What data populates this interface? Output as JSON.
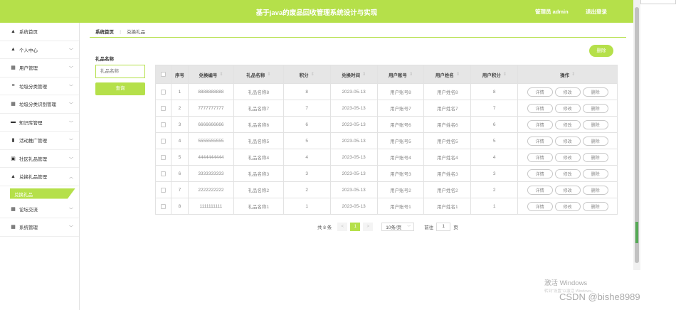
{
  "header": {
    "title": "基于java的废品回收管理系统设计与实现",
    "user": "管理员 admin",
    "logout": "退出登录"
  },
  "sidebar": {
    "items": [
      {
        "label": "系统首页",
        "icon": "home-icon",
        "glyph": "▲",
        "chevron": ""
      },
      {
        "label": "个人中心",
        "icon": "person-icon",
        "glyph": "▲",
        "chevron": "﹀"
      },
      {
        "label": "用户管理",
        "icon": "grid-icon",
        "glyph": "▦",
        "chevron": "﹀"
      },
      {
        "label": "垃圾分类管理",
        "icon": "list-icon",
        "glyph": "≡",
        "chevron": "﹀"
      },
      {
        "label": "垃圾分类识别管理",
        "icon": "grid-icon",
        "glyph": "▦",
        "chevron": "﹀"
      },
      {
        "label": "知识库管理",
        "icon": "monitor-icon",
        "glyph": "▬",
        "chevron": "﹀"
      },
      {
        "label": "活动推广管理",
        "icon": "chart-icon",
        "glyph": "▮",
        "chevron": "﹀"
      },
      {
        "label": "社区礼品管理",
        "icon": "box-icon",
        "glyph": "▣",
        "chevron": "﹀"
      },
      {
        "label": "兑换礼品管理",
        "icon": "person-icon",
        "glyph": "▲",
        "chevron": "︿"
      }
    ],
    "submenu_active": "兑换礼品",
    "items_after": [
      {
        "label": "论坛交流",
        "icon": "grid-icon",
        "glyph": "▦",
        "chevron": "﹀"
      },
      {
        "label": "系统管理",
        "icon": "grid-icon",
        "glyph": "▦",
        "chevron": "﹀"
      }
    ]
  },
  "breadcrumb": {
    "home": "系统首页",
    "sep": "⋮",
    "current": "兑换礼品"
  },
  "search": {
    "label": "礼品名称",
    "placeholder": "礼品名称",
    "button": "查询"
  },
  "toolbar": {
    "delete_label": "删除"
  },
  "table": {
    "columns": [
      "序号",
      "兑换编号",
      "礼品名称",
      "积分",
      "兑换时间",
      "用户账号",
      "用户姓名",
      "用户积分",
      "操作"
    ],
    "sort_glyph": "⇕",
    "actions": [
      "详情",
      "修改",
      "删除"
    ],
    "rows": [
      {
        "idx": "1",
        "code": "8888888888",
        "gift": "礼品名称8",
        "points": "8",
        "time": "2023-05-13",
        "account": "用户账号8",
        "name": "用户姓名8",
        "user_points": "8"
      },
      {
        "idx": "2",
        "code": "7777777777",
        "gift": "礼品名称7",
        "points": "7",
        "time": "2023-05-13",
        "account": "用户账号7",
        "name": "用户姓名7",
        "user_points": "7"
      },
      {
        "idx": "3",
        "code": "6666666666",
        "gift": "礼品名称6",
        "points": "6",
        "time": "2023-05-13",
        "account": "用户账号6",
        "name": "用户姓名6",
        "user_points": "6"
      },
      {
        "idx": "4",
        "code": "5555555555",
        "gift": "礼品名称5",
        "points": "5",
        "time": "2023-05-13",
        "account": "用户账号5",
        "name": "用户姓名5",
        "user_points": "5"
      },
      {
        "idx": "5",
        "code": "4444444444",
        "gift": "礼品名称4",
        "points": "4",
        "time": "2023-05-13",
        "account": "用户账号4",
        "name": "用户姓名4",
        "user_points": "4"
      },
      {
        "idx": "6",
        "code": "3333333333",
        "gift": "礼品名称3",
        "points": "3",
        "time": "2023-05-13",
        "account": "用户账号3",
        "name": "用户姓名3",
        "user_points": "3"
      },
      {
        "idx": "7",
        "code": "2222222222",
        "gift": "礼品名称2",
        "points": "2",
        "time": "2023-05-13",
        "account": "用户账号2",
        "name": "用户姓名2",
        "user_points": "2"
      },
      {
        "idx": "8",
        "code": "1111111111",
        "gift": "礼品名称1",
        "points": "1",
        "time": "2023-05-13",
        "account": "用户账号1",
        "name": "用户姓名1",
        "user_points": "1"
      }
    ]
  },
  "pagination": {
    "total": "共 8 条",
    "prev": "<",
    "current": "1",
    "next": ">",
    "page_size": "10条/页",
    "goto_label": "前往",
    "goto_value": "1",
    "page_suffix": "页"
  },
  "watermark": {
    "line1": "激活 Windows",
    "line2": "转到“设置”以激活 Windows。",
    "csdn": "CSDN @bishe8989"
  },
  "colors": {
    "accent": "#b5e04a",
    "header_bg": "#e6e6e6",
    "border": "#e2e2e2"
  }
}
